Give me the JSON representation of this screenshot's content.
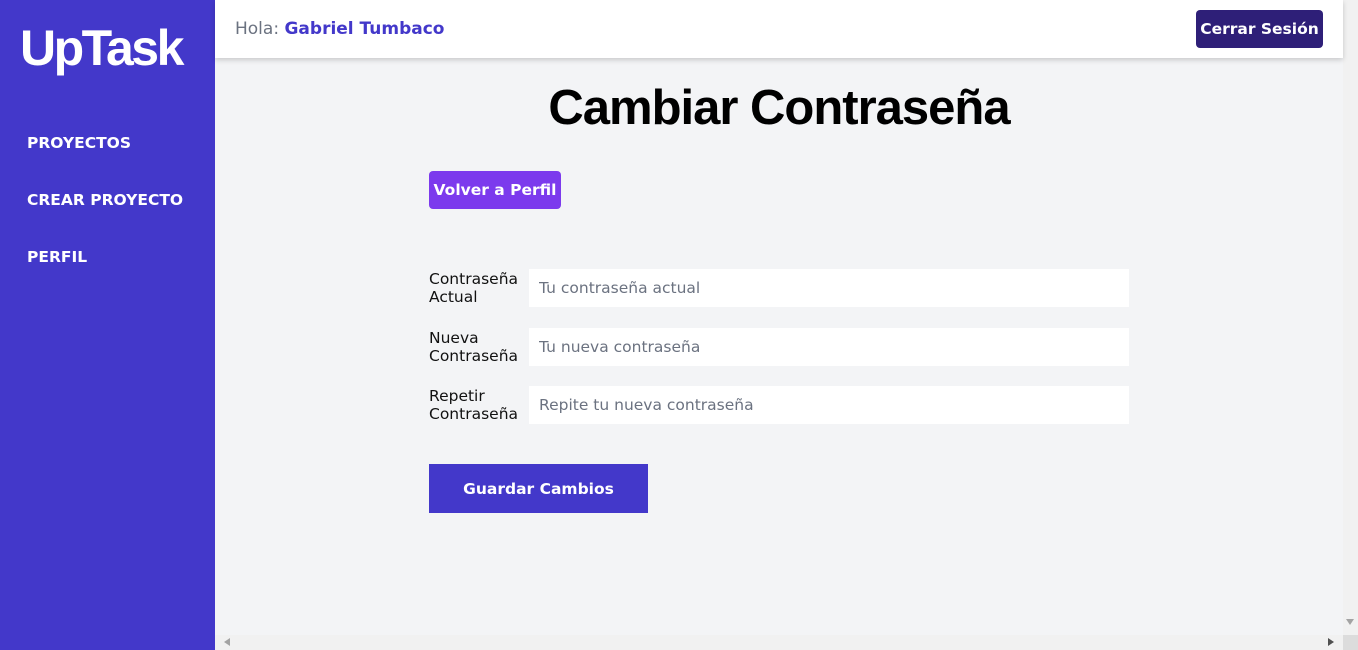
{
  "sidebar": {
    "logo": "UpTask",
    "items": [
      {
        "label": "PROYECTOS"
      },
      {
        "label": "CREAR PROYECTO"
      },
      {
        "label": "PERFIL"
      }
    ]
  },
  "header": {
    "greeting_prefix": "Hola:",
    "user_name": "Gabriel Tumbaco",
    "logout_label": "Cerrar Sesión"
  },
  "main": {
    "title": "Cambiar Contraseña",
    "back_label": "Volver a Perfil",
    "fields": [
      {
        "label": "Contraseña Actual",
        "placeholder": "Tu contraseña actual",
        "value": ""
      },
      {
        "label": "Nueva Contraseña",
        "placeholder": "Tu nueva contraseña",
        "value": ""
      },
      {
        "label": "Repetir Contraseña",
        "placeholder": "Repite tu nueva contraseña",
        "value": ""
      }
    ],
    "submit_label": "Guardar Cambios"
  },
  "colors": {
    "sidebar": "#4338ca",
    "accent_dark": "#2e1f78",
    "accent_purple": "#7c3aed",
    "background": "#f3f4f6"
  }
}
